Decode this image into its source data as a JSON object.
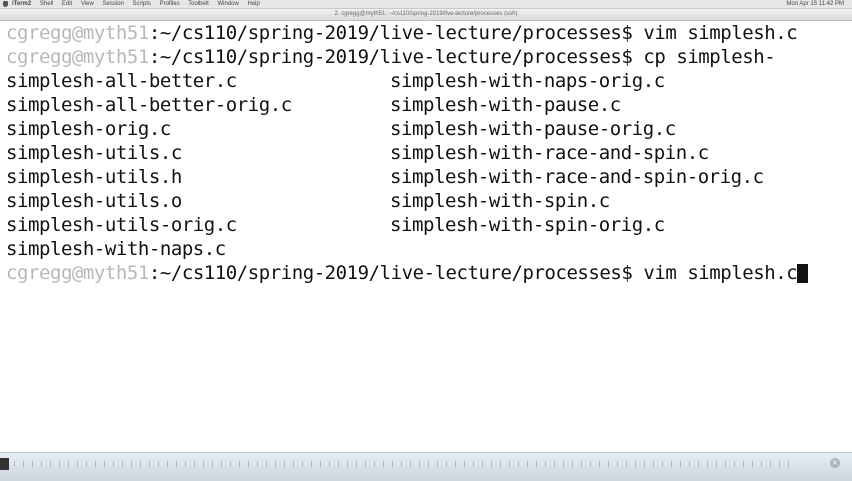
{
  "menubar": {
    "app_name": "iTerm2",
    "items": [
      "Shell",
      "Edit",
      "View",
      "Session",
      "Scripts",
      "Profiles",
      "Toolbelt",
      "Window",
      "Help"
    ],
    "clock": "Mon Apr 15  11:42 PM"
  },
  "window": {
    "title": "2. cgregg@myth51: ~/cs110/spring-2019/live-lecture/processes (ssh)"
  },
  "terminal": {
    "lines": [
      {
        "user": "cgregg@myth51",
        "rest": ":~/cs110/spring-2019/live-lecture/processes$ vim simplesh.c"
      },
      {
        "user": "cgregg@myth51",
        "rest": ":~/cs110/spring-2019/live-lecture/processes$ cp simplesh-"
      }
    ],
    "listing_col1": [
      "simplesh-all-better.c",
      "simplesh-all-better-orig.c",
      "simplesh-orig.c",
      "simplesh-utils.c",
      "simplesh-utils.h",
      "simplesh-utils.o",
      "simplesh-utils-orig.c",
      "simplesh-with-naps.c"
    ],
    "listing_col2": [
      "simplesh-with-naps-orig.c",
      "simplesh-with-pause.c",
      "simplesh-with-pause-orig.c",
      "simplesh-with-race-and-spin.c",
      "simplesh-with-race-and-spin-orig.c",
      "simplesh-with-spin.c",
      "simplesh-with-spin-orig.c"
    ],
    "current": {
      "user": "cgregg@myth51",
      "rest": ":~/cs110/spring-2019/live-lecture/processes$ vim simplesh.c"
    }
  }
}
